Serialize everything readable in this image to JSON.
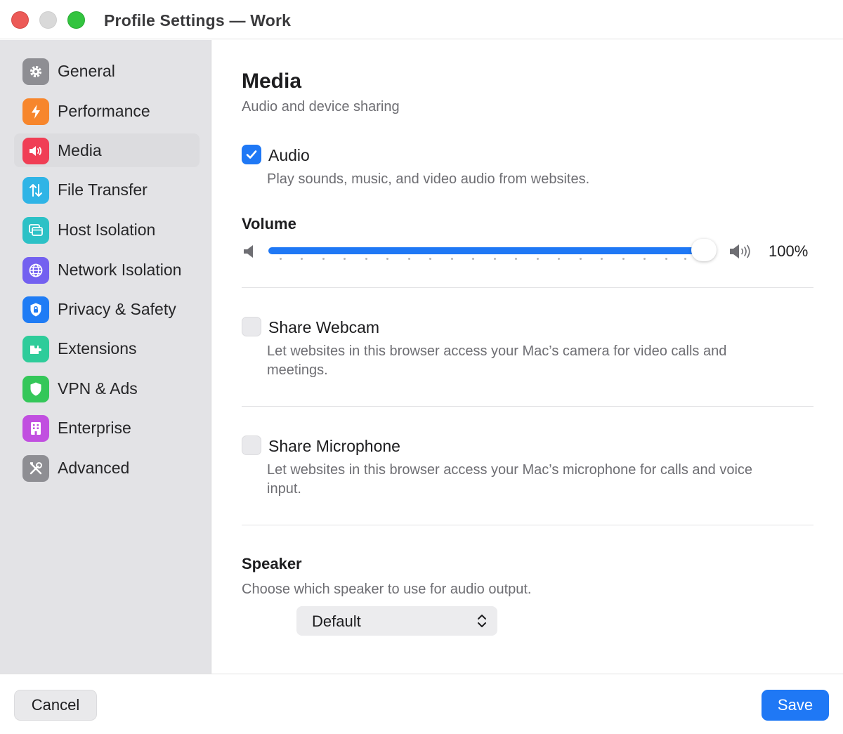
{
  "window": {
    "title": "Profile Settings — Work"
  },
  "sidebar": {
    "items": [
      {
        "label": "General",
        "icon": "gear-icon",
        "color": "#8e8e93"
      },
      {
        "label": "Performance",
        "icon": "bolt-icon",
        "color": "#f7862c"
      },
      {
        "label": "Media",
        "icon": "speaker-icon",
        "color": "#f03e55"
      },
      {
        "label": "File Transfer",
        "icon": "transfer-arrows-icon",
        "color": "#2fb4e6"
      },
      {
        "label": "Host Isolation",
        "icon": "windows-icon",
        "color": "#2cc1c6"
      },
      {
        "label": "Network Isolation",
        "icon": "globe-icon",
        "color": "#7360f0"
      },
      {
        "label": "Privacy & Safety",
        "icon": "lock-shield-icon",
        "color": "#1f7cf5"
      },
      {
        "label": "Extensions",
        "icon": "puzzle-icon",
        "color": "#2ecc9a"
      },
      {
        "label": "VPN & Ads",
        "icon": "shield-icon",
        "color": "#34c759"
      },
      {
        "label": "Enterprise",
        "icon": "building-icon",
        "color": "#c14fe0"
      },
      {
        "label": "Advanced",
        "icon": "tools-icon",
        "color": "#8e8e93"
      }
    ],
    "active": "Media"
  },
  "main": {
    "title": "Media",
    "subtitle": "Audio and device sharing",
    "audio": {
      "label": "Audio",
      "checked": true,
      "description": "Play sounds, music, and video audio from websites."
    },
    "volume": {
      "title": "Volume",
      "value": 100,
      "display": "100%"
    },
    "webcam": {
      "label": "Share Webcam",
      "checked": false,
      "description": "Let websites in this browser access your Mac’s camera for video calls and meetings."
    },
    "microphone": {
      "label": "Share Microphone",
      "checked": false,
      "description": "Let websites in this browser access your Mac’s microphone for calls and voice input."
    },
    "speaker": {
      "title": "Speaker",
      "description": "Choose which speaker to use for audio output.",
      "selected": "Default"
    }
  },
  "footer": {
    "cancel_label": "Cancel",
    "save_label": "Save"
  },
  "colors": {
    "accent": "#1f78f5",
    "sidebar_bg": "#e3e3e6"
  }
}
